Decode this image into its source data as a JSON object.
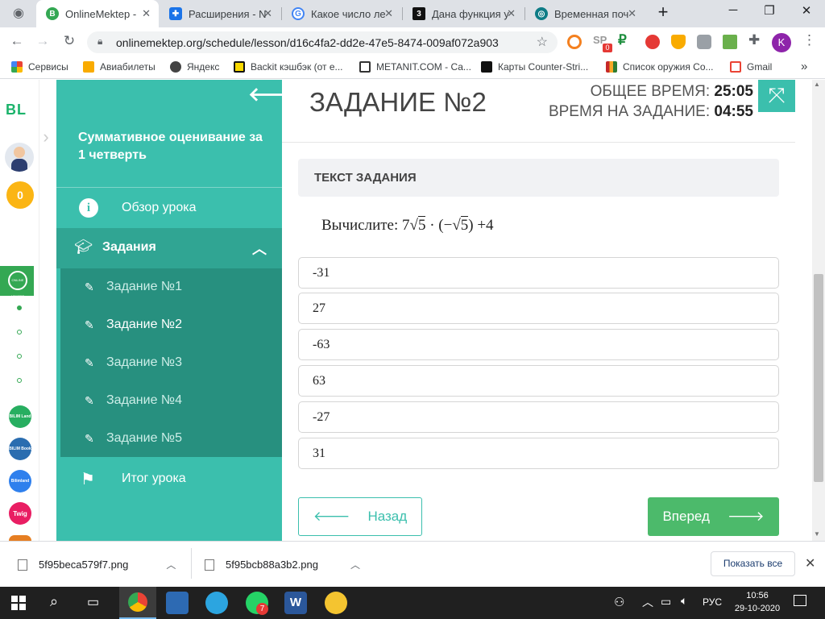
{
  "browser": {
    "tabs": [
      {
        "title": "OnlineMektep -",
        "active": true,
        "icon": "onlinemektep-icon"
      },
      {
        "title": "Расширения - N",
        "active": false,
        "icon": "extension-puzzle-icon"
      },
      {
        "title": "Какое число ле",
        "active": false,
        "icon": "google-icon"
      },
      {
        "title": "Дана функция у",
        "active": false,
        "icon": "znanija-icon"
      },
      {
        "title": "Временная поч",
        "active": false,
        "icon": "tempmail-icon"
      }
    ],
    "url": "onlinemektep.org/schedule/lesson/d16c4fa2-dd2e-47e5-8474-009af072a903",
    "profile_initial": "K",
    "sp_badge": "0",
    "bookmarks": [
      {
        "label": "Сервисы"
      },
      {
        "label": "Авиабилеты"
      },
      {
        "label": "Яндекс"
      },
      {
        "label": "Backit кэшбэк (от е..."
      },
      {
        "label": "METANIT.COM - Са..."
      },
      {
        "label": "Карты Counter-Stri..."
      },
      {
        "label": "Список оружия Co..."
      },
      {
        "label": "Gmail"
      }
    ],
    "more_bookmarks": "»"
  },
  "rail": {
    "logo": "BL",
    "coins": "0",
    "apps": [
      {
        "label": "ONLINE MEKTEP"
      },
      {
        "label": "BILIM Land"
      },
      {
        "label": "BILIM Book"
      },
      {
        "label": "Bilimland"
      },
      {
        "label": "Twig"
      }
    ]
  },
  "sidebar": {
    "title": "Суммативное оценивание за 1 четверть",
    "overview": "Обзор урока",
    "tasks_label": "Задания",
    "tasks": [
      {
        "label": "Задание №1"
      },
      {
        "label": "Задание №2"
      },
      {
        "label": "Задание №3"
      },
      {
        "label": "Задание №4"
      },
      {
        "label": "Задание №5"
      }
    ],
    "current_task_index": 1,
    "result": "Итог урока"
  },
  "main": {
    "task_title": "ЗАДАНИЕ №2",
    "total_time_label": "ОБЩЕЕ ВРЕМЯ:",
    "total_time": "25:05",
    "task_time_label": "ВРЕМЯ НА ЗАДАНИЕ:",
    "task_time": "04:55",
    "task_text_header": "ТЕКСТ ЗАДАНИЯ",
    "question_prefix": "Вычислите:",
    "question_expr": {
      "coef": "7",
      "radicand": "5",
      "dot": "·",
      "suffix": "+4"
    },
    "options": [
      "-31",
      "27",
      "-63",
      "63",
      "-27",
      "31"
    ],
    "back_label": "Назад",
    "next_label": "Вперед"
  },
  "downloads": {
    "files": [
      {
        "name": "5f95beca579f7.png"
      },
      {
        "name": "5f95bcb88a3b2.png"
      }
    ],
    "show_all": "Показать все"
  },
  "taskbar": {
    "time": "10:56",
    "date": "29-10-2020",
    "lang": "РУС",
    "telegram_badge": "7"
  },
  "colors": {
    "sidebar": "#3bbfad",
    "sidebar_active": "#30a593",
    "submenu": "#27907f",
    "next_button": "#4cba6b",
    "back_border": "#3bbfad"
  }
}
